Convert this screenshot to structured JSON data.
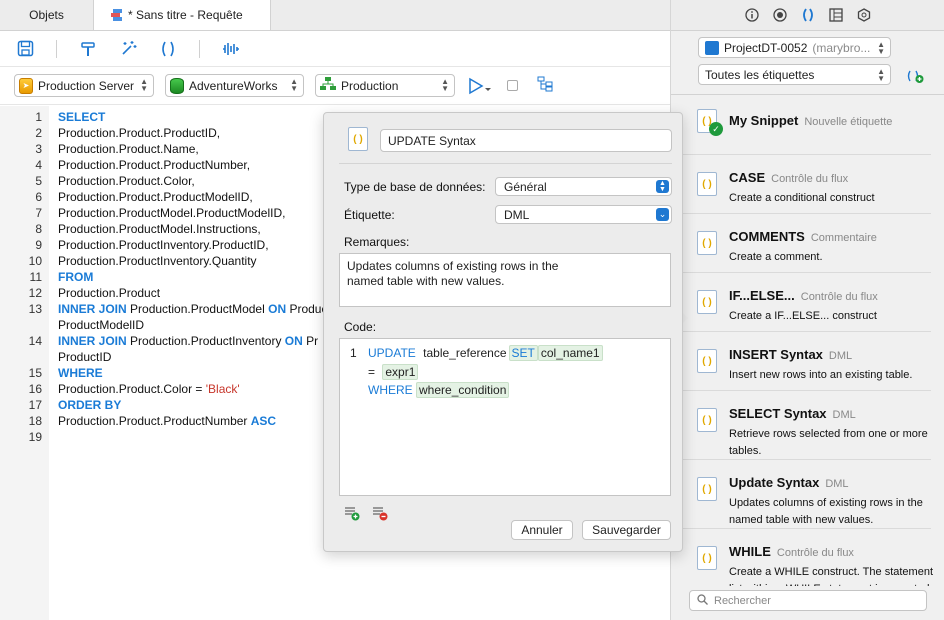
{
  "tabs": {
    "objects": "Objets",
    "query": "* Sans titre - Requête"
  },
  "connection": {
    "server": "Production Server",
    "database": "AdventureWorks",
    "schema": "Production"
  },
  "editor": {
    "line_numbers": [
      "1",
      "2",
      "3",
      "4",
      "5",
      "6",
      "7",
      "8",
      "9",
      "10",
      "11",
      "12",
      "13",
      "",
      "14",
      "",
      "15",
      "16",
      "17",
      "18",
      "19"
    ],
    "lines": [
      [
        {
          "t": "SELECT",
          "k": 1
        }
      ],
      [
        {
          "t": "Production.Product.ProductID,"
        }
      ],
      [
        {
          "t": "Production.Product.Name,"
        }
      ],
      [
        {
          "t": "Production.Product.ProductNumber,"
        }
      ],
      [
        {
          "t": "Production.Product.Color,"
        }
      ],
      [
        {
          "t": "Production.Product.ProductModelID,"
        }
      ],
      [
        {
          "t": "Production.ProductModel.ProductModelID,"
        }
      ],
      [
        {
          "t": "Production.ProductModel.Instructions,"
        }
      ],
      [
        {
          "t": "Production.ProductInventory.ProductID,"
        }
      ],
      [
        {
          "t": "Production.ProductInventory.Quantity"
        }
      ],
      [
        {
          "t": "FROM",
          "k": 1
        }
      ],
      [
        {
          "t": "Production.Product"
        }
      ],
      [
        {
          "t": "INNER JOIN",
          "k": 1
        },
        {
          "t": " Production.ProductModel "
        },
        {
          "t": "ON",
          "k": 1
        },
        {
          "t": " Produc"
        }
      ],
      [
        {
          "t": "ProductModelID"
        }
      ],
      [
        {
          "t": "INNER JOIN",
          "k": 1
        },
        {
          "t": " Production.ProductInventory "
        },
        {
          "t": "ON",
          "k": 1
        },
        {
          "t": " Pr"
        }
      ],
      [
        {
          "t": "ProductID"
        }
      ],
      [
        {
          "t": "WHERE",
          "k": 1
        }
      ],
      [
        {
          "t": "Production.Product.Color = "
        },
        {
          "t": "'Black'",
          "s": 1
        }
      ],
      [
        {
          "t": "ORDER BY",
          "k": 1
        }
      ],
      [
        {
          "t": "Production.Product.ProductNumber "
        },
        {
          "t": "ASC",
          "k": 1
        }
      ],
      []
    ]
  },
  "right": {
    "project": {
      "name": "ProjectDT-0052",
      "owner": "(marybro..."
    },
    "tag_filter": "Toutes les étiquettes",
    "snippets": [
      {
        "title": "My Snippet",
        "tag": "Nouvelle étiquette",
        "desc": "",
        "checked": true
      },
      {
        "title": "CASE",
        "tag": "Contrôle du flux",
        "desc": "Create a conditional construct"
      },
      {
        "title": "COMMENTS",
        "tag": "Commentaire",
        "desc": "Create a comment."
      },
      {
        "title": "IF...ELSE...",
        "tag": "Contrôle du flux",
        "desc": "Create a IF...ELSE... construct"
      },
      {
        "title": "INSERT Syntax",
        "tag": "DML",
        "desc": "Insert new rows into an existing table."
      },
      {
        "title": "SELECT Syntax",
        "tag": "DML",
        "desc": "Retrieve rows selected from one or more tables."
      },
      {
        "title": "Update Syntax",
        "tag": "DML",
        "desc": "Updates columns of existing rows in the named table with new values."
      },
      {
        "title": "WHILE",
        "tag": "Contrôle du flux",
        "desc": "Create a WHILE construct. The statement list within a WHILE statement is repeated"
      }
    ],
    "search_placeholder": "Rechercher"
  },
  "popover": {
    "name": "UPDATE Syntax",
    "db_type_label": "Type de base de données:",
    "db_type_value": "Général",
    "tag_label": "Étiquette:",
    "tag_value": "DML",
    "remarks_label": "Remarques:",
    "remarks": "Updates columns of existing rows in the named table with new values.",
    "code_label": "Code:",
    "code_line_number": "1",
    "code_update": "UPDATE",
    "code_table": "table_reference",
    "code_set": "SET",
    "code_col": "col_name1",
    "code_eq": "=",
    "code_expr": "expr1",
    "code_where": "WHERE",
    "code_cond": "where_condition",
    "cancel": "Annuler",
    "save": "Sauvegarder"
  }
}
